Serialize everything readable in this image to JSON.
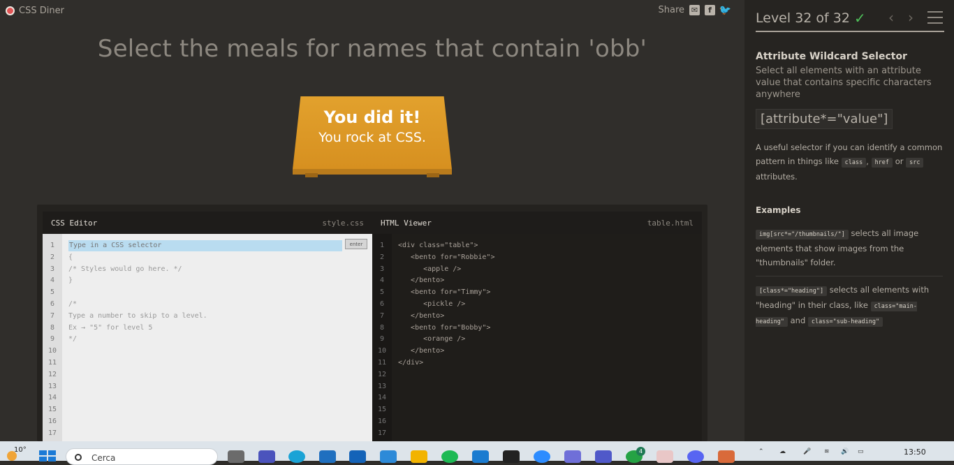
{
  "app": {
    "logo_text": "CSS Diner",
    "share_label": "Share"
  },
  "instruction": "Select the meals for names that contain 'obb'",
  "table_message": {
    "line1": "You did it!",
    "line2": "You rock at CSS."
  },
  "css_editor": {
    "title": "CSS Editor",
    "filename": "style.css",
    "input_placeholder": "Type in a CSS selector",
    "enter_label": "enter",
    "line_numbers": [
      "1",
      "2",
      "3",
      "4",
      "5",
      "6",
      "7",
      "8",
      "9",
      "10",
      "11",
      "12",
      "13",
      "14",
      "15",
      "16",
      "17"
    ],
    "lines": [
      "",
      "{",
      "/* Styles would go here. */",
      "}",
      "",
      "/*",
      "Type a number to skip to a level.",
      "Ex → \"5\" for level 5",
      "*/"
    ]
  },
  "html_viewer": {
    "title": "HTML Viewer",
    "filename": "table.html",
    "line_numbers": [
      "1",
      "2",
      "3",
      "4",
      "5",
      "6",
      "7",
      "8",
      "9",
      "10",
      "11",
      "12",
      "13",
      "14",
      "15",
      "16",
      "17"
    ],
    "lines": [
      "<div class=\"table\">",
      "   <bento for=\"Robbie\">",
      "      <apple />",
      "   </bento>",
      "   <bento for=\"Timmy\">",
      "      <pickle />",
      "   </bento>",
      "   <bento for=\"Bobby\">",
      "      <orange />",
      "   </bento>",
      "</div>"
    ]
  },
  "sidebar": {
    "level_text": "Level 32 of 32",
    "progress": 1.0,
    "heading": "Attribute Wildcard Selector",
    "description": "Select all elements with an attribute value that contains specific characters anywhere",
    "syntax": "[attribute*=\"value\"]",
    "help_p1": "A useful selector if you can identify a common pattern in things like",
    "help_code1": "class",
    "help_comma": ",",
    "help_code2": "href",
    "help_or": "or",
    "help_code3": "src",
    "help_p1_end": "attributes.",
    "examples_heading": "Examples",
    "ex1_code": "img[src*=\"/thumbnails/\"]",
    "ex1_text": "selects all image elements that show images from the \"thumbnails\" folder.",
    "ex2_code": "[class*=\"heading\"]",
    "ex2_text": "selects all elements with \"heading\" in their class, like",
    "ex2_code2": "class=\"main-heading\"",
    "ex2_and": "and",
    "ex2_code3": "class=\"sub-heading\""
  },
  "taskbar": {
    "temperature": "10°",
    "search_placeholder": "Cerca",
    "badge_count": "4",
    "time": "13:50"
  },
  "colors": {
    "accent_table": "#e2a12d",
    "check": "#4fc15a",
    "selection": "#b9dcf0"
  }
}
